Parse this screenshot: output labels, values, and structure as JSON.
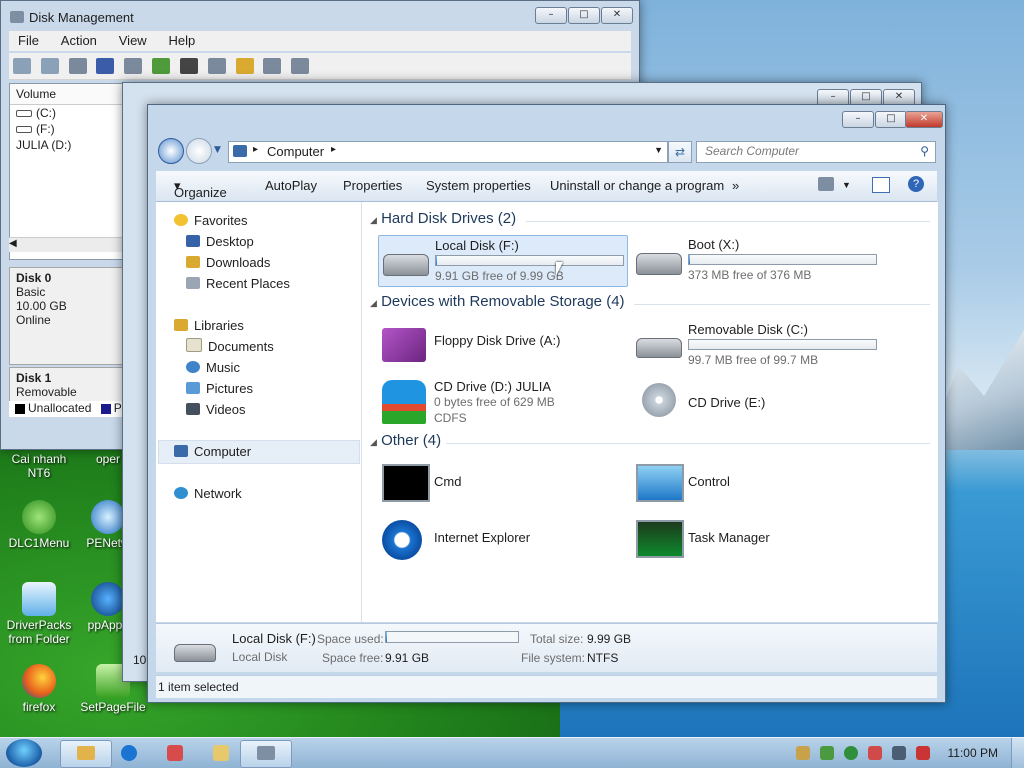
{
  "desktop": {
    "icons": [
      {
        "label": "Cai nhanh\nNT6"
      },
      {
        "label": "oper"
      },
      {
        "label": "DLC1Menu"
      },
      {
        "label": "PENetw"
      },
      {
        "label": "DriverPacks\nfrom Folder"
      },
      {
        "label": "ppApps"
      },
      {
        "label": "firefox"
      },
      {
        "label": "SetPageFile"
      }
    ]
  },
  "disk_mgmt": {
    "title": "Disk Management",
    "menu": [
      "File",
      "Action",
      "View",
      "Help"
    ],
    "list_header": "Volume",
    "volumes": [
      "(C:)",
      "(F:)",
      "JULIA (D:)"
    ],
    "disk0": {
      "name": "Disk 0",
      "type": "Basic",
      "size": "10.00 GB",
      "status": "Online"
    },
    "disk1": {
      "name": "Disk 1",
      "type": "Removable"
    },
    "legend": {
      "unallocated": "Unallocated",
      "primary": "P"
    },
    "bottom_fragment": "10"
  },
  "explorer": {
    "address": "Computer",
    "search_placeholder": "Search Computer",
    "commands": [
      "Organize",
      "AutoPlay",
      "Properties",
      "System properties",
      "Uninstall or change a program",
      "»"
    ],
    "nav": {
      "favorites": "Favorites",
      "fav_items": [
        "Desktop",
        "Downloads",
        "Recent Places"
      ],
      "libraries": "Libraries",
      "lib_items": [
        "Documents",
        "Music",
        "Pictures",
        "Videos"
      ],
      "computer": "Computer",
      "network": "Network"
    },
    "groups": {
      "hdd": "Hard Disk Drives (2)",
      "removable": "Devices with Removable Storage (4)",
      "other": "Other (4)"
    },
    "drives": {
      "local_f": {
        "name": "Local Disk (F:)",
        "free": "9.91 GB free of 9.99 GB",
        "used_fraction": 0.008
      },
      "boot_x": {
        "name": "Boot (X:)",
        "free": "373 MB free of 376 MB",
        "used_fraction": 0.008
      },
      "floppy": {
        "name": "Floppy Disk Drive (A:)"
      },
      "removable_c": {
        "name": "Removable Disk (C:)",
        "free": "99.7 MB free of 99.7 MB",
        "used_fraction": 0.0
      },
      "cd_d": {
        "name": "CD Drive (D:) JULIA",
        "free": "0 bytes free of 629 MB",
        "fs": "CDFS"
      },
      "cd_e": {
        "name": "CD Drive (E:)"
      }
    },
    "other_items": [
      "Cmd",
      "Control",
      "Internet Explorer",
      "Task Manager"
    ],
    "details": {
      "name": "Local Disk (F:)",
      "kind": "Local Disk",
      "space_used_label": "Space used:",
      "space_free_label": "Space free:",
      "space_free": "9.91 GB",
      "total_size_label": "Total size:",
      "total_size": "9.99 GB",
      "fs_label": "File system:",
      "fs": "NTFS"
    },
    "status": "1 item selected"
  },
  "taskbar": {
    "clock": "11:00 PM"
  }
}
